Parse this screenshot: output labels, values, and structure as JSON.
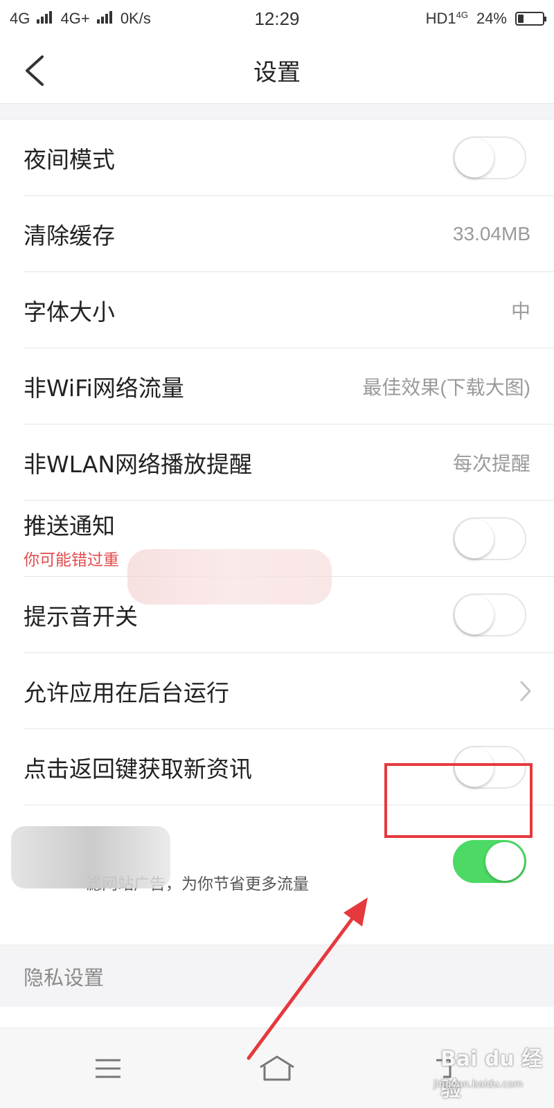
{
  "status_bar": {
    "network_1": "4G",
    "network_2": "4G+",
    "speed": "0K/s",
    "time": "12:29",
    "hd": "HD1",
    "network_3": "4G",
    "battery_percent": "24%",
    "battery_level": 0.24
  },
  "header": {
    "title": "设置"
  },
  "settings": {
    "night_mode": {
      "label": "夜间模式",
      "enabled": false
    },
    "clear_cache": {
      "label": "清除缓存",
      "value": "33.04MB"
    },
    "font_size": {
      "label": "字体大小",
      "value": "中"
    },
    "non_wifi_traffic": {
      "label": "非WiFi网络流量",
      "value": "最佳效果(下载大图)"
    },
    "non_wlan_reminder": {
      "label": "非WLAN网络播放提醒",
      "value": "每次提醒"
    },
    "push_notification": {
      "label": "推送通知",
      "sublabel": "你可能错过重",
      "enabled": false
    },
    "sound_toggle": {
      "label": "提示音开关",
      "enabled": false
    },
    "background_run": {
      "label": "允许应用在后台运行"
    },
    "back_refresh": {
      "label": "点击返回键获取新资讯",
      "enabled": false
    },
    "ad_filter": {
      "sublabel": "滤网站广告，为你节省更多流量",
      "enabled": true
    }
  },
  "privacy_section": {
    "title": "隐私设置"
  },
  "watermark": {
    "brand": "Bai du 经验",
    "url": "jingyan.baidu.com"
  },
  "colors": {
    "toggle_on": "#4cd964",
    "highlight": "#e5393d",
    "sub_text_red": "#e14b4b"
  }
}
